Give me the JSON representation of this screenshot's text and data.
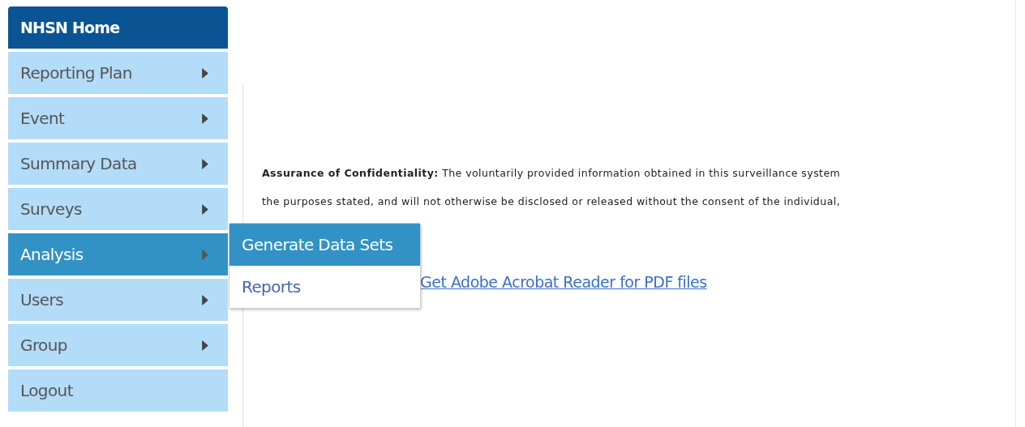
{
  "sidebar": {
    "title": "NHSN Home",
    "items": [
      {
        "label": "Reporting Plan",
        "selected": false,
        "has_submenu": true
      },
      {
        "label": "Event",
        "selected": false,
        "has_submenu": true
      },
      {
        "label": "Summary Data",
        "selected": false,
        "has_submenu": true
      },
      {
        "label": "Surveys",
        "selected": false,
        "has_submenu": true
      },
      {
        "label": "Analysis",
        "selected": true,
        "has_submenu": true
      },
      {
        "label": "Users",
        "selected": false,
        "has_submenu": true
      },
      {
        "label": "Group",
        "selected": false,
        "has_submenu": true
      },
      {
        "label": "Logout",
        "selected": false,
        "has_submenu": false
      }
    ]
  },
  "submenu": {
    "items": [
      {
        "label": "Generate Data Sets",
        "selected": true
      },
      {
        "label": "Reports",
        "selected": false
      }
    ]
  },
  "content": {
    "notice_lines": [
      "**Assurance of Confidentiality:** The voluntarily provided information obtained in this surveillance system",
      "the purposes stated, and will not otherwise be disclosed or released without the consent of the individual,"
    ],
    "link": "Get Adobe Acrobat Reader for PDF files"
  }
}
